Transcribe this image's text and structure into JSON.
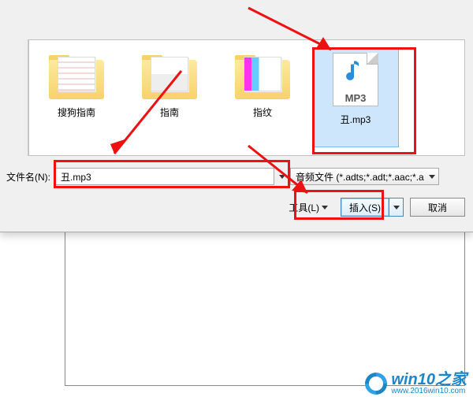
{
  "files": [
    {
      "label": "搜狗指南",
      "type": "folder"
    },
    {
      "label": "指南",
      "type": "folder"
    },
    {
      "label": "指纹",
      "type": "folder"
    },
    {
      "label": "丑.mp3",
      "type": "mp3",
      "selected": true,
      "mp3_badge": "MP3"
    }
  ],
  "filename_row": {
    "label": "文件名(N):",
    "value": "丑.mp3",
    "filter": "音频文件 (*.adts;*.adt;*.aac;*.a"
  },
  "tools": {
    "label": "工具(L)",
    "insert": "插入(S)",
    "cancel": "取消"
  },
  "watermark": {
    "brand": "win10之家",
    "url": "www.2016win10.com"
  }
}
